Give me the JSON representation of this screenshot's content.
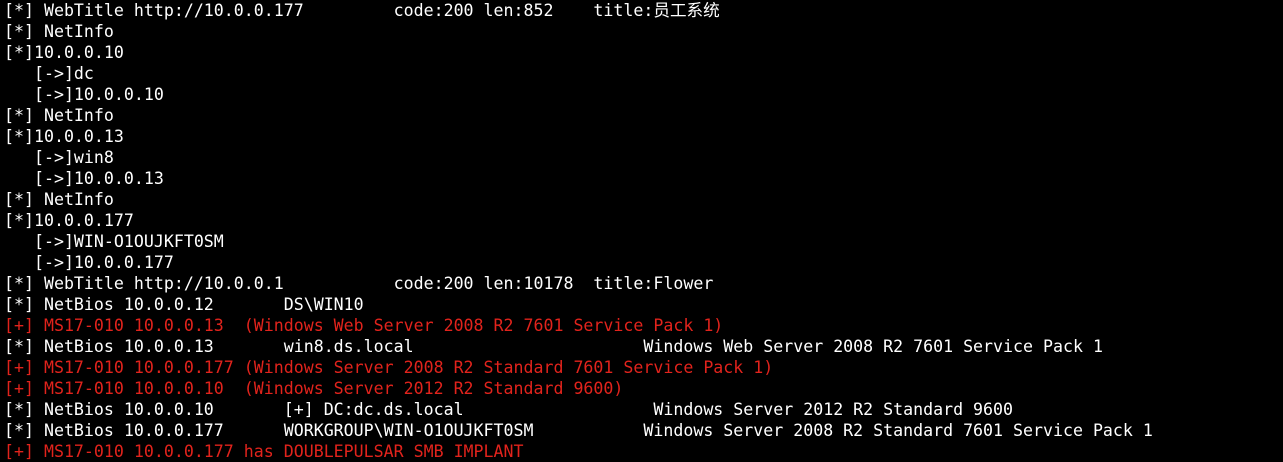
{
  "theme": {
    "background": "#000000",
    "text_color": "#ffffff",
    "highlight_color": "#e1231c"
  },
  "terminal": {
    "lines": [
      {
        "text": "[*] WebTitle http://10.0.0.177         code:200 len:852    title:员工系统",
        "color": "white"
      },
      {
        "text": "[*] NetInfo",
        "color": "white"
      },
      {
        "text": "[*]10.0.0.10",
        "color": "white"
      },
      {
        "text": "   [->]dc",
        "color": "white"
      },
      {
        "text": "   [->]10.0.0.10",
        "color": "white"
      },
      {
        "text": "[*] NetInfo",
        "color": "white"
      },
      {
        "text": "[*]10.0.0.13",
        "color": "white"
      },
      {
        "text": "   [->]win8",
        "color": "white"
      },
      {
        "text": "   [->]10.0.0.13",
        "color": "white"
      },
      {
        "text": "[*] NetInfo",
        "color": "white"
      },
      {
        "text": "[*]10.0.0.177",
        "color": "white"
      },
      {
        "text": "   [->]WIN-O1OUJKFT0SM",
        "color": "white"
      },
      {
        "text": "   [->]10.0.0.177",
        "color": "white"
      },
      {
        "text": "[*] WebTitle http://10.0.0.1           code:200 len:10178  title:Flower",
        "color": "white"
      },
      {
        "text": "[*] NetBios 10.0.0.12       DS\\WIN10",
        "color": "white"
      },
      {
        "text": "[+] MS17-010 10.0.0.13  (Windows Web Server 2008 R2 7601 Service Pack 1)",
        "color": "red"
      },
      {
        "text": "[*] NetBios 10.0.0.13       win8.ds.local                       Windows Web Server 2008 R2 7601 Service Pack 1",
        "color": "white"
      },
      {
        "text": "[+] MS17-010 10.0.0.177 (Windows Server 2008 R2 Standard 7601 Service Pack 1)",
        "color": "red"
      },
      {
        "text": "[+] MS17-010 10.0.0.10  (Windows Server 2012 R2 Standard 9600)",
        "color": "red"
      },
      {
        "text": "[*] NetBios 10.0.0.10       [+] DC:dc.ds.local                   Windows Server 2012 R2 Standard 9600",
        "color": "white"
      },
      {
        "text": "[*] NetBios 10.0.0.177      WORKGROUP\\WIN-O1OUJKFT0SM           Windows Server 2008 R2 Standard 7601 Service Pack 1",
        "color": "white"
      },
      {
        "text": "[+] MS17-010 10.0.0.177 has DOUBLEPULSAR SMB IMPLANT",
        "color": "red"
      }
    ]
  }
}
